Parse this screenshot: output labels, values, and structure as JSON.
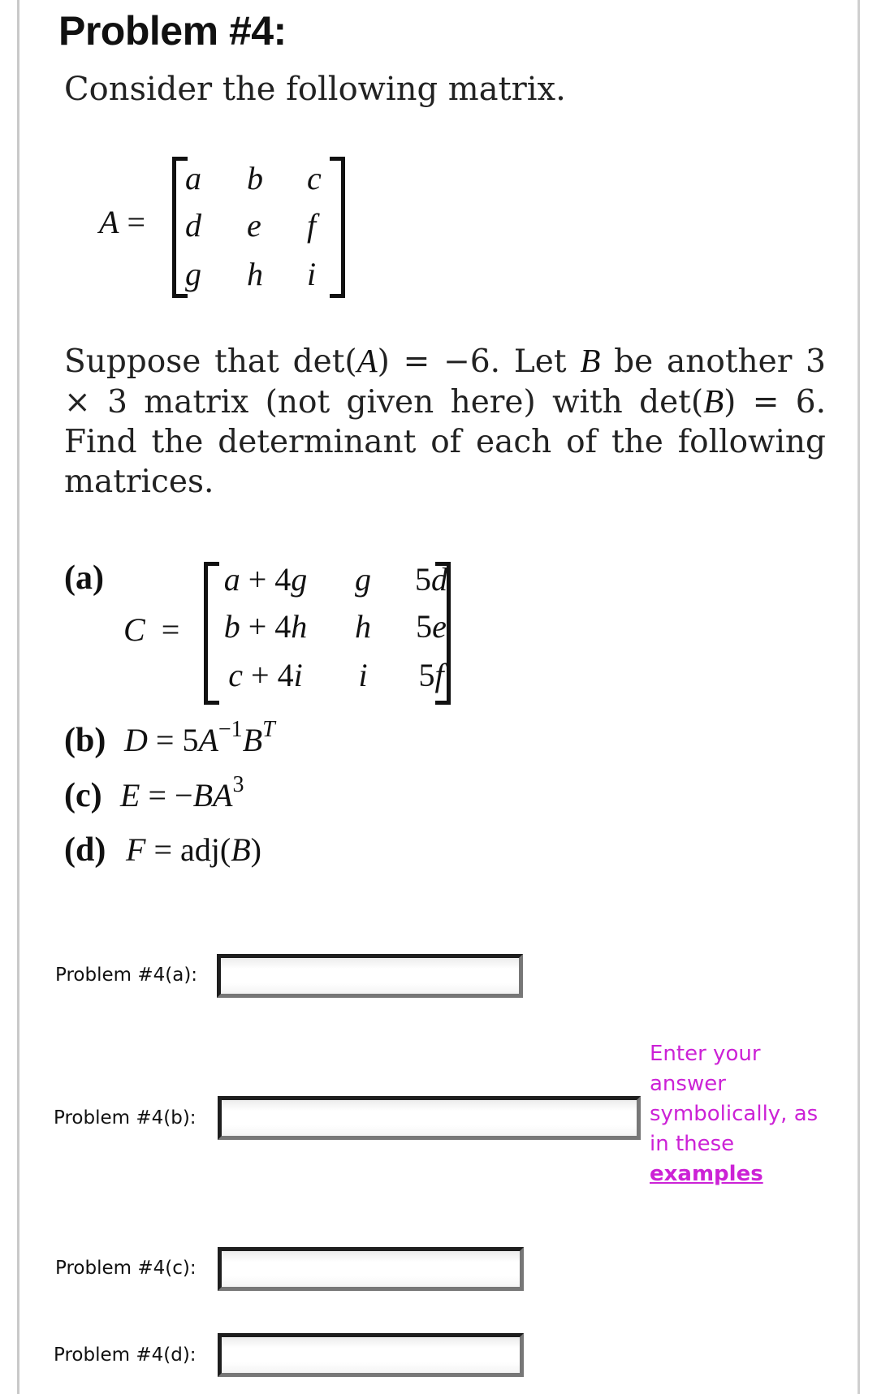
{
  "problem": {
    "title": "Problem #4:",
    "intro": "Consider the following matrix.",
    "matrix_A": {
      "name": "A",
      "equals": "=",
      "rows": [
        [
          "a",
          "b",
          "c"
        ],
        [
          "d",
          "e",
          "f"
        ],
        [
          "g",
          "h",
          "i"
        ]
      ]
    },
    "paragraph": "Suppose that det(A) = −6. Let B be another 3 × 3 matrix (not given here) with det(B) = 6. Find the determinant of each of the following matrices.",
    "paragraph_parts": {
      "p1": "Suppose that det(",
      "A": "A",
      "p2": ") = −6. Let ",
      "B1": "B",
      "p3": " be another 3 × 3 matrix (not given here) with det(",
      "B2": "B",
      "p4": ") = 6. Find the determinant of each of the following matrices."
    },
    "parts": {
      "a": {
        "label": "(a)",
        "name": "C",
        "equals": "=",
        "rows": [
          [
            "a + 4g",
            "g",
            "5d"
          ],
          [
            "b + 4h",
            "h",
            "5e"
          ],
          [
            "c + 4i",
            "i",
            "5f"
          ]
        ]
      },
      "b": {
        "label": "(b)",
        "lhs": "D",
        "eq": " = 5",
        "base": "A",
        "sup1": "−1",
        "base2": "B",
        "sup2": "T"
      },
      "c": {
        "label": "(c)",
        "lhs": "E",
        "eq": " = −",
        "base": "BA",
        "sup1": "3"
      },
      "d": {
        "label": "(d)",
        "lhs": "F",
        "eq": " = adj(",
        "base": "B",
        "close": ")"
      }
    }
  },
  "answers": [
    {
      "label": "Problem #4(a):",
      "value": "",
      "placeholder": ""
    },
    {
      "label": "Problem #4(b):",
      "value": "",
      "placeholder": ""
    },
    {
      "label": "Problem #4(c):",
      "value": "",
      "placeholder": ""
    },
    {
      "label": "Problem #4(d):",
      "value": "",
      "placeholder": ""
    }
  ],
  "hint": {
    "text": "Enter your answer symbolically, as in these",
    "link": "examples",
    "color": "#cc22d6"
  }
}
